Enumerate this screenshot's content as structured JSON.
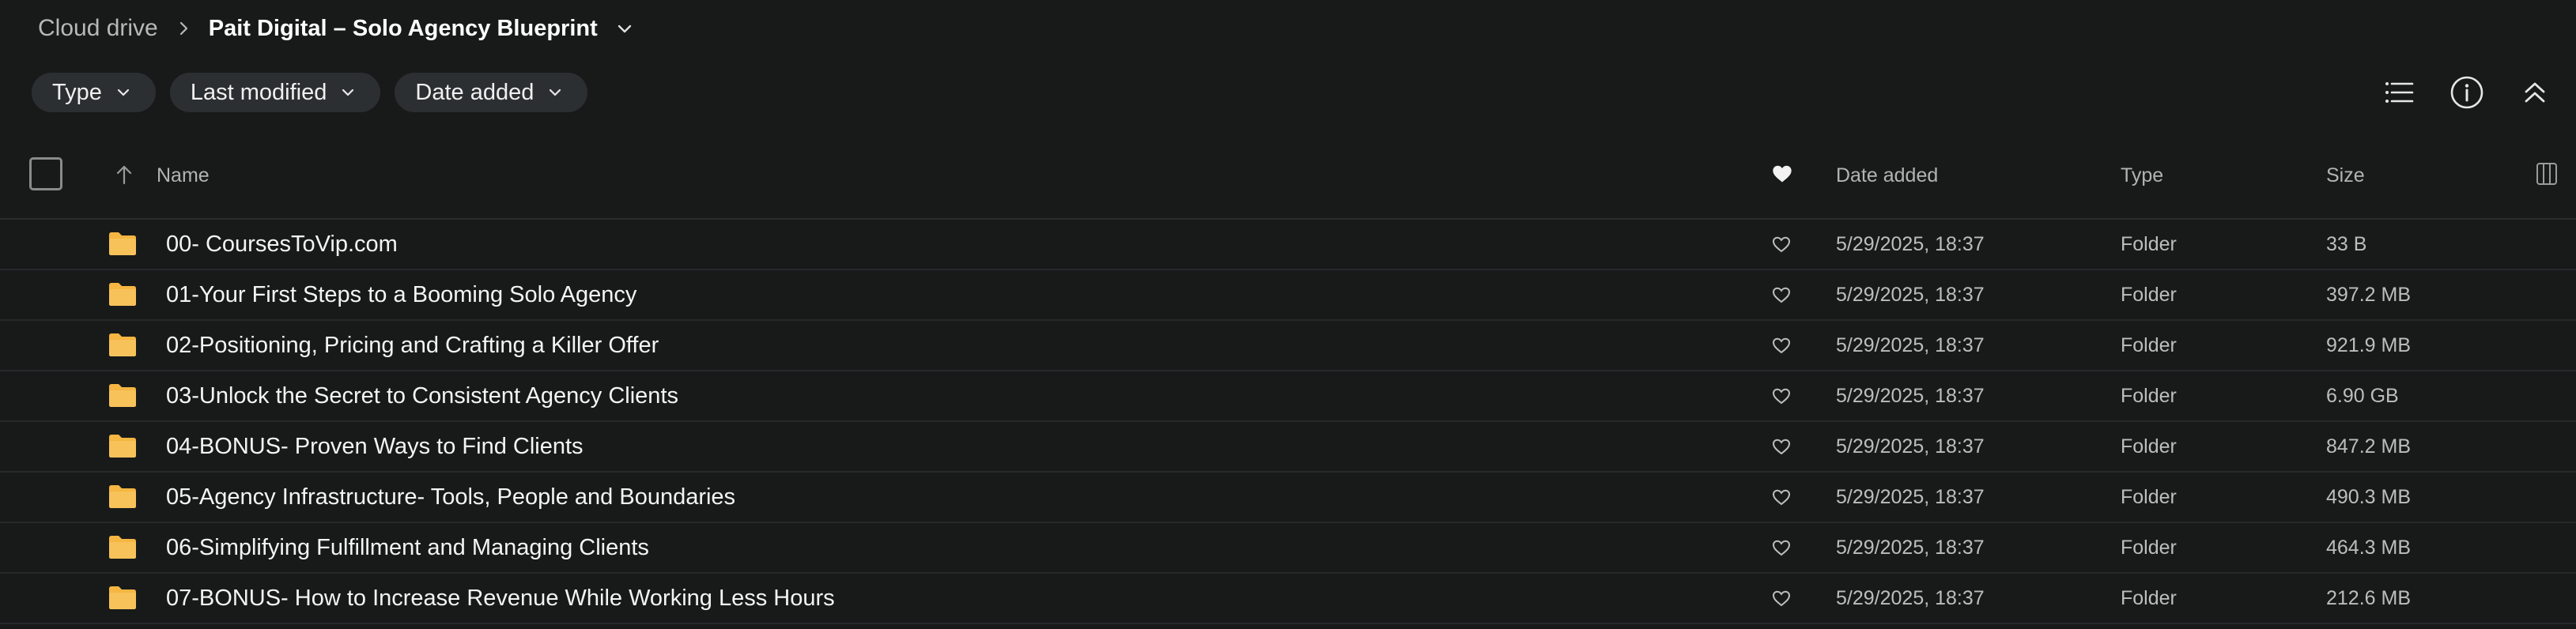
{
  "breadcrumb": {
    "root": "Cloud drive",
    "current": "Pait Digital – Solo Agency Blueprint"
  },
  "filters": [
    {
      "label": "Type"
    },
    {
      "label": "Last modified"
    },
    {
      "label": "Date added"
    }
  ],
  "toolbar_icons": [
    "list-view-icon",
    "info-icon",
    "collapse-icon"
  ],
  "table": {
    "columns": {
      "name": "Name",
      "date_added": "Date added",
      "type": "Type",
      "size": "Size"
    },
    "rows": [
      {
        "name": "00- CoursesToVip.com",
        "date_added": "5/29/2025, 18:37",
        "type": "Folder",
        "size": "33 B"
      },
      {
        "name": "01-Your First Steps to a Booming Solo Agency",
        "date_added": "5/29/2025, 18:37",
        "type": "Folder",
        "size": "397.2 MB"
      },
      {
        "name": "02-Positioning, Pricing and Crafting a Killer Offer",
        "date_added": "5/29/2025, 18:37",
        "type": "Folder",
        "size": "921.9 MB"
      },
      {
        "name": "03-Unlock the Secret to Consistent Agency Clients",
        "date_added": "5/29/2025, 18:37",
        "type": "Folder",
        "size": "6.90 GB"
      },
      {
        "name": "04-BONUS- Proven Ways to Find Clients",
        "date_added": "5/29/2025, 18:37",
        "type": "Folder",
        "size": "847.2 MB"
      },
      {
        "name": "05-Agency Infrastructure- Tools, People and Boundaries",
        "date_added": "5/29/2025, 18:37",
        "type": "Folder",
        "size": "490.3 MB"
      },
      {
        "name": "06-Simplifying Fulfillment and Managing Clients",
        "date_added": "5/29/2025, 18:37",
        "type": "Folder",
        "size": "464.3 MB"
      },
      {
        "name": "07-BONUS- How to Increase Revenue While Working Less Hours",
        "date_added": "5/29/2025, 18:37",
        "type": "Folder",
        "size": "212.6 MB"
      }
    ]
  },
  "colors": {
    "background": "#181a1a",
    "folder": "#f5b642",
    "chip": "#2c2f31"
  }
}
